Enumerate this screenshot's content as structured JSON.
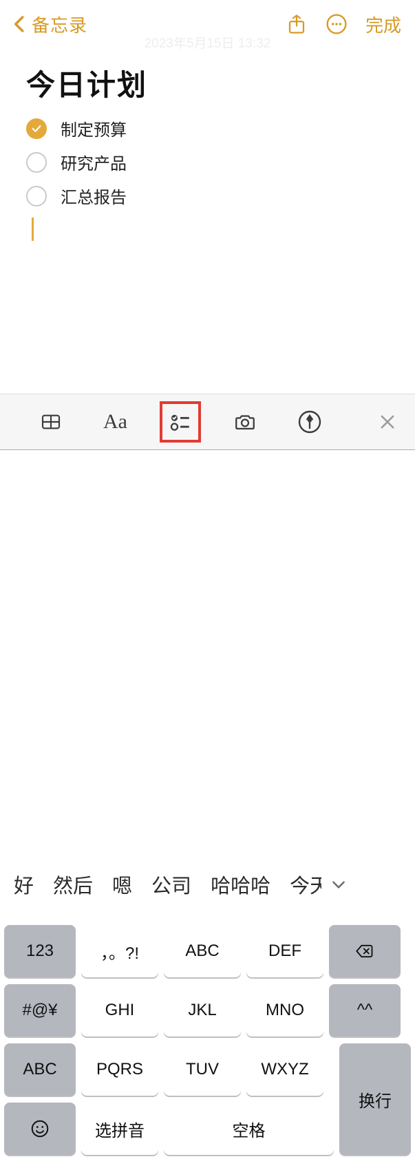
{
  "header": {
    "back_label": "备忘录",
    "done_label": "完成"
  },
  "note": {
    "datetime": "2023年5月15日 13:32",
    "title": "今日计划",
    "checklist": [
      {
        "label": "制定预算",
        "checked": true
      },
      {
        "label": "研究产品",
        "checked": false
      },
      {
        "label": "汇总报告",
        "checked": false
      }
    ]
  },
  "toolbar": {
    "format_label": "Aa"
  },
  "keyboard": {
    "suggestions": [
      "好",
      "然后",
      "嗯",
      "公司",
      "哈哈哈",
      "今天"
    ],
    "keys": {
      "num": "123",
      "punct": "，。?!",
      "abc": "ABC",
      "def": "DEF",
      "sym": "#@¥",
      "ghi": "GHI",
      "jkl": "JKL",
      "mno": "MNO",
      "caps": "^^",
      "abc_mode": "ABC",
      "pqrs": "PQRS",
      "tuv": "TUV",
      "wxyz": "WXYZ",
      "pinyin": "选拼音",
      "space": "空格",
      "enter": "换行"
    }
  }
}
